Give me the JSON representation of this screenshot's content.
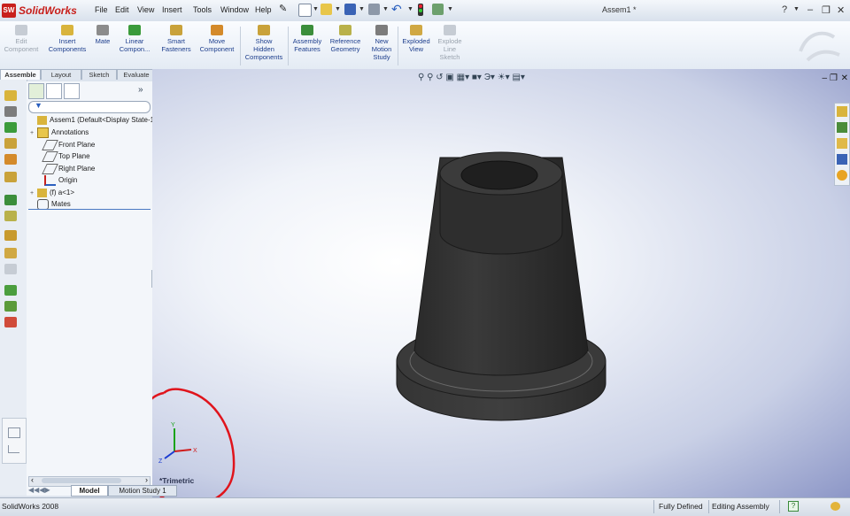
{
  "app": {
    "logo_badge": "SW",
    "name": "SolidWorks",
    "document_title": "Assem1 *"
  },
  "menu": [
    "File",
    "Edit",
    "View",
    "Insert",
    "Tools",
    "Window",
    "Help"
  ],
  "window_controls": {
    "help": "?",
    "restore": "–",
    "maximize": "❐",
    "close": "✕"
  },
  "command_manager": [
    {
      "label": "Edit\nComponent",
      "enabled": false
    },
    {
      "label": "Insert\nComponents",
      "enabled": true
    },
    {
      "label": "Mate",
      "enabled": true
    },
    {
      "label": "Linear\nCompon...",
      "enabled": true
    },
    {
      "label": "Smart\nFasteners",
      "enabled": true
    },
    {
      "label": "Move\nComponent",
      "enabled": true
    },
    {
      "label": "Show\nHidden\nComponents",
      "enabled": true
    },
    {
      "label": "Assembly\nFeatures",
      "enabled": true
    },
    {
      "label": "Reference\nGeometry",
      "enabled": true
    },
    {
      "label": "New\nMotion\nStudy",
      "enabled": true
    },
    {
      "label": "Exploded\nView",
      "enabled": true
    },
    {
      "label": "Explode\nLine\nSketch",
      "enabled": false
    }
  ],
  "command_tabs": [
    "Assemble",
    "Layout",
    "Sketch",
    "Evaluate"
  ],
  "feature_tree": [
    {
      "label": "Assem1  (Default<Display State-1",
      "expander": "",
      "indent": 0,
      "icon": "assembly-icon"
    },
    {
      "label": "Annotations",
      "expander": "+",
      "indent": 1,
      "icon": "annotations-icon"
    },
    {
      "label": "Front Plane",
      "expander": "",
      "indent": 1,
      "icon": "plane-icon"
    },
    {
      "label": "Top Plane",
      "expander": "",
      "indent": 1,
      "icon": "plane-icon"
    },
    {
      "label": "Right Plane",
      "expander": "",
      "indent": 1,
      "icon": "plane-icon"
    },
    {
      "label": "Origin",
      "expander": "",
      "indent": 1,
      "icon": "origin-icon"
    },
    {
      "label": "(f) a<1>",
      "expander": "+",
      "indent": 1,
      "icon": "part-icon"
    },
    {
      "label": "Mates",
      "expander": "",
      "indent": 1,
      "icon": "mates-icon"
    }
  ],
  "viewport": {
    "view_name": "*Trimetric"
  },
  "bottom_tabs": [
    "Model",
    "Motion Study 1"
  ],
  "status": {
    "app_version": "SolidWorks 2008",
    "state": "Fully Defined",
    "mode": "Editing Assembly",
    "help": "?"
  },
  "colors": {
    "part": "#2f2f2f",
    "annotation_circle": "#e0141c",
    "accent": "#c8201c"
  }
}
